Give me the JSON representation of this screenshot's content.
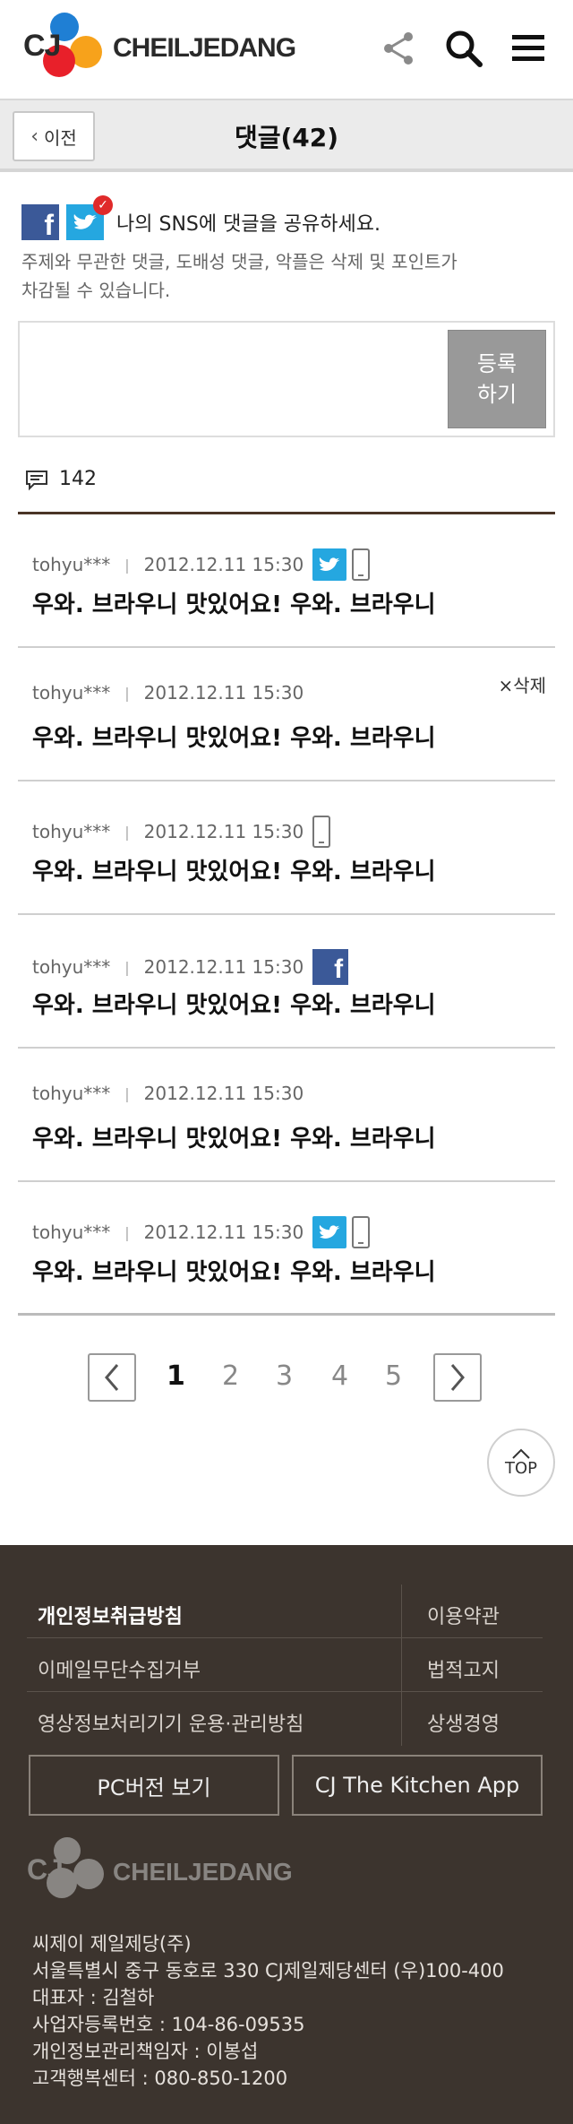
{
  "header": {
    "logo_cj": "CJ",
    "logo_text": "CHEILJEDANG"
  },
  "titlebar": {
    "back_label": "이전",
    "title": "댓글(42)"
  },
  "sns": {
    "prompt": "나의 SNS에 댓글을 공유하세요.",
    "notice_line1": "주제와 무관한 댓글, 도배성 댓글, 악플은 삭제 및 포인트가",
    "notice_line2": "차감될 수 있습니다."
  },
  "comment_form": {
    "submit_line1": "등록",
    "submit_line2": "하기"
  },
  "comment_count": "142",
  "comments": [
    {
      "user": "tohyu***",
      "date": "2012.12.11  15:30",
      "text": "우와. 브라우니 맛있어요! 우와. 브라우니",
      "badges": [
        "twitter",
        "mobile"
      ],
      "delete_label": ""
    },
    {
      "user": "tohyu***",
      "date": "2012.12.11  15:30",
      "text": "우와. 브라우니 맛있어요! 우와. 브라우니",
      "badges": [],
      "delete_label": "×삭제"
    },
    {
      "user": "tohyu***",
      "date": "2012.12.11  15:30",
      "text": "우와. 브라우니 맛있어요! 우와. 브라우니",
      "badges": [
        "mobile"
      ],
      "delete_label": ""
    },
    {
      "user": "tohyu***",
      "date": "2012.12.11  15:30",
      "text": "우와. 브라우니 맛있어요! 우와. 브라우니",
      "badges": [
        "facebook"
      ],
      "delete_label": ""
    },
    {
      "user": "tohyu***",
      "date": "2012.12.11  15:30",
      "text": "우와. 브라우니 맛있어요! 우와. 브라우니",
      "badges": [],
      "delete_label": ""
    },
    {
      "user": "tohyu***",
      "date": "2012.12.11  15:30",
      "text": "우와. 브라우니 맛있어요! 우와. 브라우니",
      "badges": [
        "twitter",
        "mobile"
      ],
      "delete_label": ""
    }
  ],
  "pagination": {
    "pages": [
      "1",
      "2",
      "3",
      "4",
      "5"
    ],
    "current": "1",
    "top_label": "TOP"
  },
  "footer": {
    "links": [
      {
        "left": "개인정보취급방침",
        "right": "이용약관"
      },
      {
        "left": "이메일무단수집거부",
        "right": "법적고지"
      },
      {
        "left": "영상정보처리기기 운용·관리방침",
        "right": "상생경영"
      }
    ],
    "pc_button": "PC버전 보기",
    "app_button": "CJ The Kitchen App",
    "logo_cj": "CJ",
    "logo_text": "CHEILJEDANG",
    "info": [
      "씨제이 제일제당(주)",
      "서울특별시 중구 동호로 330 CJ제일제당센터 (우)100-400",
      "대표자 : 김철하",
      "사업자등록번호 : 104-86-09535",
      "개인정보관리책임자 : 이봉섭",
      "고객행복센터 : 080-850-1200"
    ]
  },
  "colors": {
    "footer_bg": "#3c342e",
    "count_divider": "#4a3426",
    "facebook": "#3b5998",
    "twitter": "#25a7e0",
    "submit_bg": "#999999"
  }
}
